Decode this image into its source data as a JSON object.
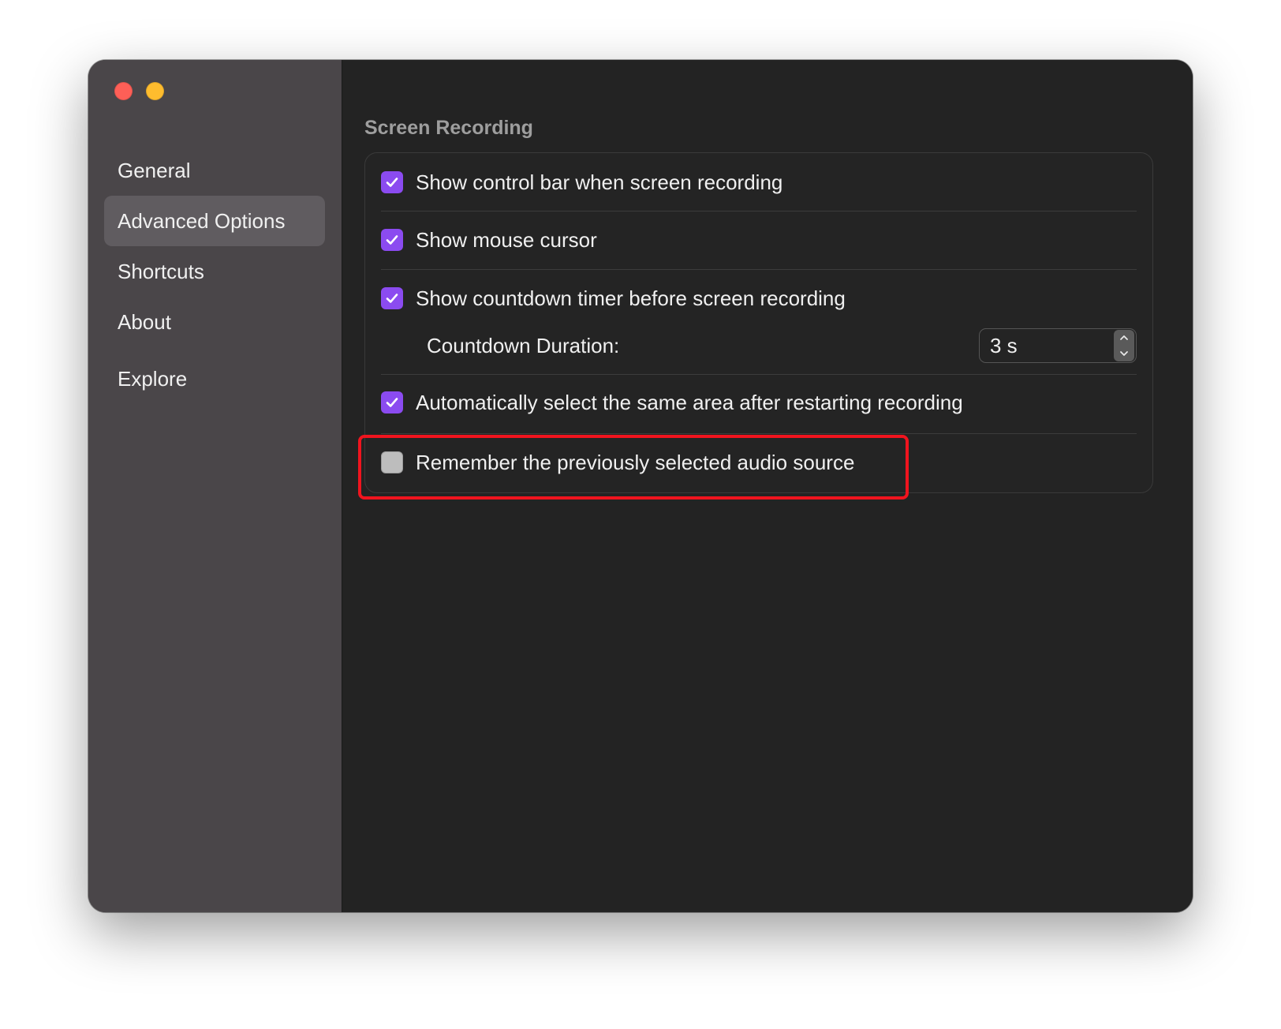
{
  "window": {
    "traffic_lights": {
      "close": {
        "color": "#fe5f57",
        "icon": "close-icon"
      },
      "minimize": {
        "color": "#febc2e",
        "icon": "minimize-icon"
      }
    }
  },
  "sidebar": {
    "items": [
      {
        "label": "General",
        "active": false
      },
      {
        "label": "Advanced Options",
        "active": true
      },
      {
        "label": "Shortcuts",
        "active": false
      },
      {
        "label": "About",
        "active": false
      },
      {
        "label": "Explore",
        "active": false
      }
    ]
  },
  "main": {
    "section_title": "Screen Recording",
    "options": [
      {
        "label": "Show control bar when screen recording",
        "checked": true
      },
      {
        "label": "Show mouse cursor",
        "checked": true
      },
      {
        "label": "Show countdown timer before screen recording",
        "checked": true
      },
      {
        "label": "Automatically select the same area after restarting recording",
        "checked": true
      },
      {
        "label": "Remember the previously selected audio source",
        "checked": false
      }
    ],
    "countdown": {
      "label": "Countdown Duration:",
      "value": "3 s"
    }
  },
  "colors": {
    "accent": "#8b4bf0",
    "highlight": "#f0141e",
    "sidebar_bg": "#4a4649",
    "content_bg": "#232323"
  }
}
